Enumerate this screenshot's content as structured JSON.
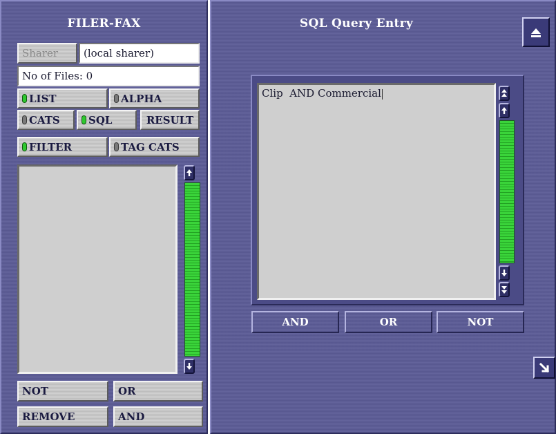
{
  "filer": {
    "title": "FILER-FAX",
    "sharer_button": "Sharer",
    "sharer_value": "(local sharer)",
    "file_count": "No of Files: 0",
    "mode_buttons": {
      "list": "LIST",
      "alpha": "ALPHA",
      "cats": "CATS",
      "sql": "SQL",
      "result": "RESULT",
      "filter": "FILTER",
      "tag_cats": "TAG CATS"
    },
    "bottom_buttons": {
      "not": "NOT",
      "or": "OR",
      "remove": "REMOVE",
      "and": "AND"
    }
  },
  "sql_entry": {
    "title": "SQL Query Entry",
    "query_text": "Clip  AND Commercial",
    "operator_buttons": {
      "and": "AND",
      "or": "OR",
      "not": "NOT"
    }
  },
  "colors": {
    "panel": "#5b5b96",
    "led_on": "#2ec82e",
    "led_off": "#7a7a7a",
    "scroll_track": "#3ad43a"
  },
  "icons": {
    "eject": "eject-icon",
    "resize": "resize-arrow-icon",
    "scroll_up": "arrow-up-icon",
    "scroll_down": "arrow-down-icon",
    "scroll_top": "double-arrow-up-icon",
    "scroll_bottom": "double-arrow-down-icon"
  }
}
